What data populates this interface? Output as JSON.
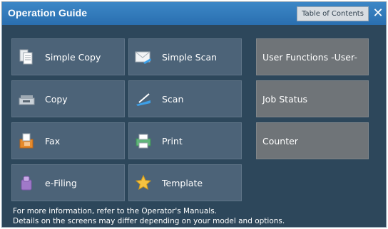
{
  "window": {
    "title": "Operation Guide",
    "toc_label": "Table of Contents",
    "close_glyph": "✕"
  },
  "tiles": [
    {
      "label": "Simple Copy",
      "icon": "simple-copy-icon"
    },
    {
      "label": "Simple Scan",
      "icon": "simple-scan-icon"
    },
    {
      "label": "User Functions -User-",
      "icon": ""
    },
    {
      "label": "Copy",
      "icon": "copy-icon"
    },
    {
      "label": "Scan",
      "icon": "scan-icon"
    },
    {
      "label": "Job Status",
      "icon": ""
    },
    {
      "label": "Fax",
      "icon": "fax-icon"
    },
    {
      "label": "Print",
      "icon": "print-icon"
    },
    {
      "label": "Counter",
      "icon": ""
    },
    {
      "label": "e-Filing",
      "icon": "e-filing-icon"
    },
    {
      "label": "Template",
      "icon": "template-icon"
    }
  ],
  "notes": {
    "line1": "For more information, refer to the Operator's Manuals.",
    "line2": "Details on the screens may differ depending on your model and options."
  },
  "colors": {
    "titlebar": "#3179bc",
    "panel": "#2d475b",
    "tile": "#4c6378",
    "tile_grey": "#6f7478"
  }
}
